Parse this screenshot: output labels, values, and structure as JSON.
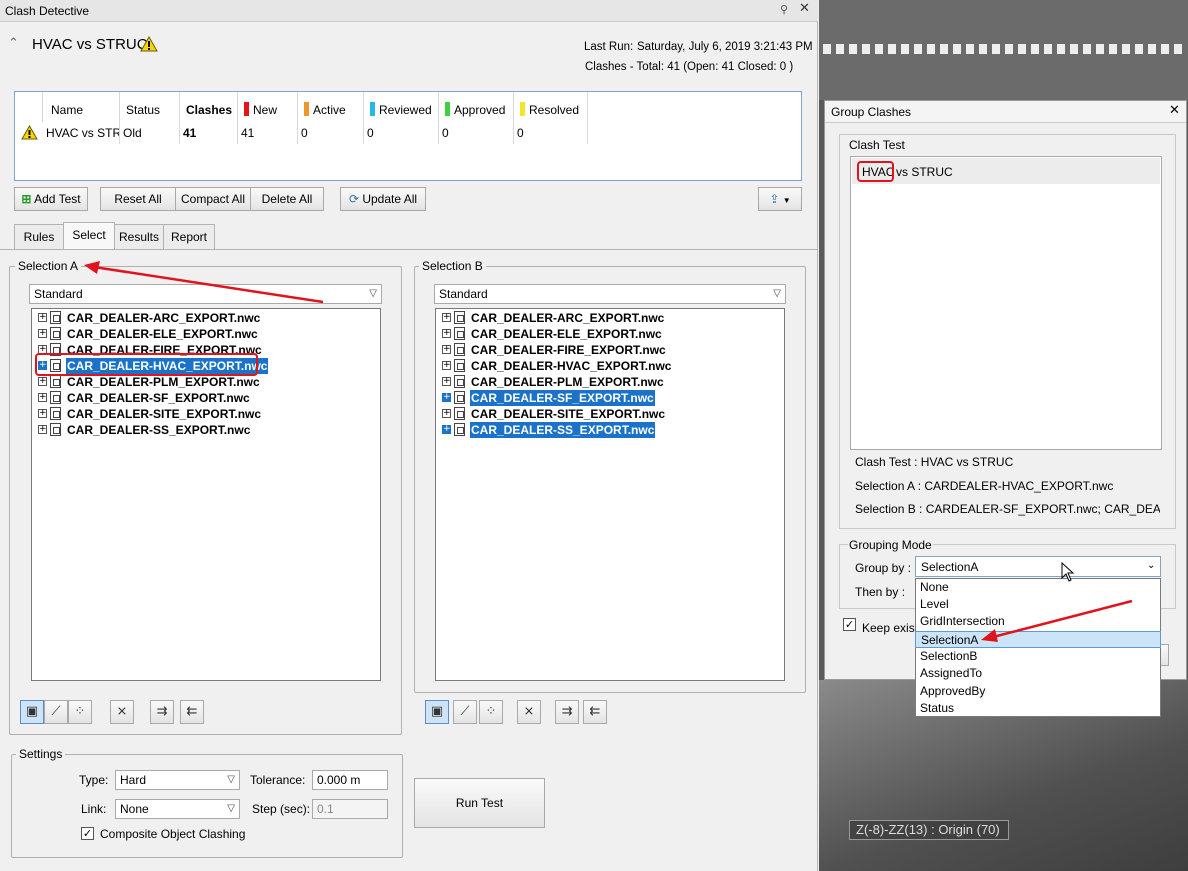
{
  "clash_detective": {
    "window_title": "Clash Detective",
    "current_test": "HVAC vs STRUC",
    "last_run_label": "Last Run:",
    "last_run_value": "Saturday, July 6, 2019 3:21:43 PM",
    "clashes_summary": "Clashes -  Total:  41  (Open:  41  Closed:  0 )",
    "table": {
      "headers": [
        "Name",
        "Status",
        "Clashes",
        "New",
        "Active",
        "Reviewed",
        "Approved",
        "Resolved"
      ],
      "header_colors": {
        "New": "#e8141c",
        "Active": "#f0962a",
        "Reviewed": "#29b6e8",
        "Approved": "#3fcf3f",
        "Resolved": "#f2e629"
      },
      "row": {
        "name": "HVAC vs STRUC",
        "status": "Old",
        "clashes": "41",
        "new": "41",
        "active": "0",
        "reviewed": "0",
        "approved": "0",
        "resolved": "0"
      }
    },
    "buttons": {
      "add_test": "Add Test",
      "reset_all": "Reset All",
      "compact_all": "Compact All",
      "delete_all": "Delete All",
      "update_all": "Update All"
    },
    "tabs": [
      "Rules",
      "Select",
      "Results",
      "Report"
    ],
    "active_tab": "Select",
    "selection_a": {
      "title": "Selection A",
      "dropdown": "Standard",
      "items": [
        "CAR_DEALER-ARC_EXPORT.nwc",
        "CAR_DEALER-ELE_EXPORT.nwc",
        "CAR_DEALER-FIRE_EXPORT.nwc",
        "CAR_DEALER-HVAC_EXPORT.nwc",
        "CAR_DEALER-PLM_EXPORT.nwc",
        "CAR_DEALER-SF_EXPORT.nwc",
        "CAR_DEALER-SITE_EXPORT.nwc",
        "CAR_DEALER-SS_EXPORT.nwc"
      ],
      "selected": [
        "CAR_DEALER-HVAC_EXPORT.nwc"
      ]
    },
    "selection_b": {
      "title": "Selection B",
      "dropdown": "Standard",
      "items": [
        "CAR_DEALER-ARC_EXPORT.nwc",
        "CAR_DEALER-ELE_EXPORT.nwc",
        "CAR_DEALER-FIRE_EXPORT.nwc",
        "CAR_DEALER-HVAC_EXPORT.nwc",
        "CAR_DEALER-PLM_EXPORT.nwc",
        "CAR_DEALER-SF_EXPORT.nwc",
        "CAR_DEALER-SITE_EXPORT.nwc",
        "CAR_DEALER-SS_EXPORT.nwc"
      ],
      "selected": [
        "CAR_DEALER-SF_EXPORT.nwc",
        "CAR_DEALER-SS_EXPORT.nwc"
      ]
    },
    "settings": {
      "title": "Settings",
      "type_label": "Type:",
      "type_value": "Hard",
      "tolerance_label": "Tolerance:",
      "tolerance_value": "0.000 m",
      "link_label": "Link:",
      "link_value": "None",
      "step_label": "Step (sec):",
      "step_value": "0.1",
      "composite_label": "Composite Object Clashing",
      "composite_checked": true
    },
    "run_test": "Run Test"
  },
  "group_clashes": {
    "title": "Group Clashes",
    "clash_test_label": "Clash Test",
    "list_item": {
      "hvac": "HVAC",
      "rest": " vs STRUC"
    },
    "info_clash_test": "Clash Test : HVAC vs STRUC",
    "info_sel_a": "Selection A : CARDEALER-HVAC_EXPORT.nwc",
    "info_sel_b": "Selection B : CARDEALER-SF_EXPORT.nwc; CAR_DEALER-SS_",
    "grouping_mode": "Grouping Mode",
    "group_by_label": "Group by :",
    "group_by_value": "SelectionA",
    "then_by_label": "Then by :",
    "keep_existing": "Keep existi",
    "options": [
      "None",
      "Level",
      "GridIntersection",
      "SelectionA",
      "SelectionB",
      "AssignedTo",
      "ApprovedBy",
      "Status"
    ],
    "highlighted_option": "SelectionA"
  },
  "viewport": {
    "overlay_text": "Z(-8)-ZZ(13) : Origin (70)"
  }
}
